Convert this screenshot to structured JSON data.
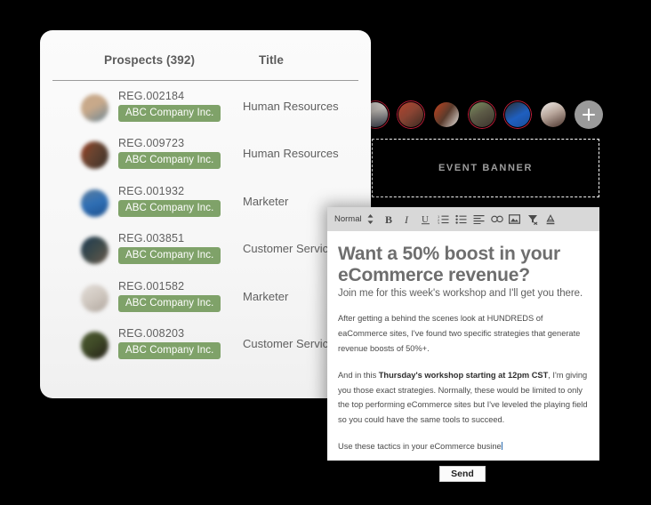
{
  "prospects_panel": {
    "columns": {
      "prospects": "Prospects (392)",
      "title": "Title"
    },
    "badge_color": "#7fa269",
    "rows": [
      {
        "reg": "REG.002184",
        "company": "ABC Company Inc.",
        "title": "Human Resources",
        "avatar_colors": [
          "#c8a98a",
          "#6d8796"
        ]
      },
      {
        "reg": "REG.009723",
        "company": "ABC Company Inc.",
        "title": "Human Resources",
        "avatar_colors": [
          "#9c3b1e",
          "#3a3029"
        ]
      },
      {
        "reg": "REG.001932",
        "company": "ABC Company Inc.",
        "title": "Marketer",
        "avatar_colors": [
          "#2f6fb5",
          "#1d4f8c"
        ]
      },
      {
        "reg": "REG.003851",
        "company": "ABC Company Inc.",
        "title": "Customer Service",
        "avatar_colors": [
          "#1d3a52",
          "#6b5a4c"
        ]
      },
      {
        "reg": "REG.001582",
        "company": "ABC Company Inc.",
        "title": "Marketer",
        "avatar_colors": [
          "#d8d2cc",
          "#b0a79f"
        ]
      },
      {
        "reg": "REG.008203",
        "company": "ABC Company Inc.",
        "title": "Customer Service",
        "avatar_colors": [
          "#3f4a27",
          "#241f18"
        ]
      }
    ]
  },
  "avatar_strip": {
    "ring_color": "#c41e3a",
    "add_button_label": "+",
    "avatars": [
      {
        "name": "avatar-1",
        "ringed": true,
        "colors": [
          "#d8a271",
          "#7d9ab4"
        ]
      },
      {
        "name": "avatar-2",
        "ringed": true,
        "colors": [
          "#e8e4df",
          "#2b3140"
        ]
      },
      {
        "name": "avatar-3",
        "ringed": true,
        "colors": [
          "#b5452f",
          "#3a2a22"
        ]
      },
      {
        "name": "avatar-4",
        "ringed": false,
        "colors": [
          "#c2431f",
          "#e7e4e0"
        ]
      },
      {
        "name": "avatar-5",
        "ringed": true,
        "colors": [
          "#7b8f5e",
          "#3b332c"
        ]
      },
      {
        "name": "avatar-6",
        "ringed": true,
        "colors": [
          "#1f5fbf",
          "#2b2f33"
        ]
      },
      {
        "name": "avatar-7",
        "ringed": false,
        "colors": [
          "#f0ece8",
          "#4a332c"
        ]
      }
    ]
  },
  "event_banner": {
    "label": "EVENT BANNER"
  },
  "composer": {
    "toolbar": {
      "format_value": "Normal",
      "icons": [
        "bold-icon",
        "italic-icon",
        "underline-icon",
        "ordered-list-icon",
        "bullet-list-icon",
        "align-left-icon",
        "link-icon",
        "image-icon",
        "clear-format-icon",
        "text-color-icon"
      ]
    },
    "heading": "Want a 50% boost in your eCommerce revenue?",
    "subheading": "Join me for this week's workshop and I'll get you there.",
    "paragraph_1_line_1": "After getting a behind the scenes look at HUNDREDS of eaCommerce sites,",
    "paragraph_1_line_2": "I've found two specific strategies that generate revenue boosts of 50%+.",
    "paragraph_2_a": "And in this ",
    "paragraph_2_bold": "Thursday's workshop starting at 12pm CST",
    "paragraph_2_b": ", I'm giving you those exact strategies. Normally, these would be limited to only the top performing eCommerce sites but I've leveled the playing field so you could have the same tools to succeed.",
    "paragraph_3": "Use these tactics in your eCommerce busine"
  },
  "send_button": {
    "label": "Send"
  }
}
